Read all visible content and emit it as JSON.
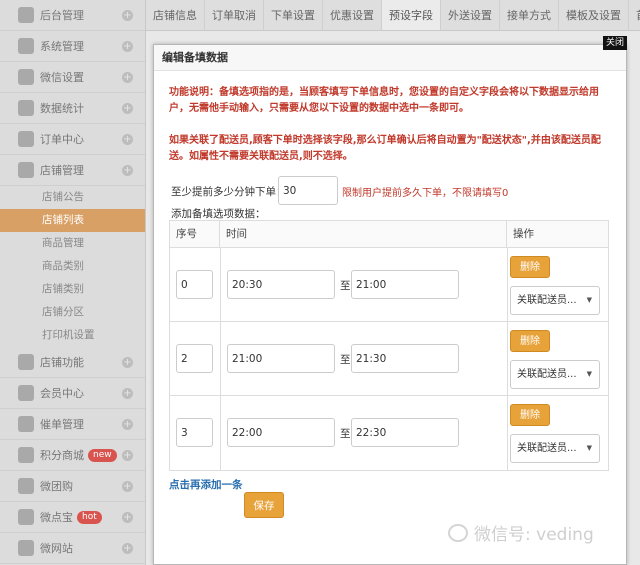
{
  "sidebar": {
    "items": [
      {
        "label": "后台管理",
        "icon": "grid-icon"
      },
      {
        "label": "系统管理",
        "icon": "grid-icon"
      },
      {
        "label": "微信设置",
        "icon": "mail-icon"
      },
      {
        "label": "数据统计",
        "icon": "chart-icon"
      },
      {
        "label": "订单中心",
        "icon": "cart-icon"
      },
      {
        "label": "店铺管理",
        "icon": "store-icon"
      }
    ],
    "store_sub": [
      "店铺公告",
      "店铺列表",
      "商品管理",
      "商品类别",
      "店铺类别",
      "店铺分区",
      "打印机设置"
    ],
    "active_sub": "店铺列表",
    "lower_items": [
      {
        "label": "店铺功能",
        "icon": "plus-icon",
        "badge": ""
      },
      {
        "label": "会员中心",
        "icon": "user-icon",
        "badge": ""
      },
      {
        "label": "催单管理",
        "icon": "grid-icon",
        "badge": ""
      },
      {
        "label": "积分商城",
        "icon": "gift-icon",
        "badge": "new"
      },
      {
        "label": "微团购",
        "icon": "group-icon",
        "badge": ""
      },
      {
        "label": "微点宝",
        "icon": "star-icon",
        "badge": "hot"
      },
      {
        "label": "微网站",
        "icon": "globe-icon",
        "badge": ""
      }
    ]
  },
  "tabs": [
    "店铺信息",
    "订单取消",
    "下单设置",
    "优惠设置",
    "预设字段",
    "外送设置",
    "接单方式",
    "模板及设置",
    "首页"
  ],
  "active_tab": "预设字段",
  "modal": {
    "close_label": "关闭",
    "title": "编辑备填数据",
    "desc1": "功能说明：备填选项指的是，当顾客填写下单信息时，您设置的自定义字段会将以下数据显示给用户，无需他手动输入，只需要从您以下设置的数据中选中一条即可。",
    "desc2": "如果关联了配送员,顾客下单时选择该字段,那么订单确认后将自动置为\"配送状态\",并由该配送员配送。如属性不需要关联配送员,则不选择。",
    "advance_label": "至少提前多少分钟下单：",
    "advance_value": "30",
    "advance_hint": "限制用户提前多久下单，不限请填写0",
    "table_label": "添加备填选项数据：",
    "headers": {
      "seq": "序号",
      "time": "时间",
      "op": "操作"
    },
    "to_label": "至",
    "delete_label": "删除",
    "select_placeholder": "关联配送员...",
    "rows": [
      {
        "seq": "0",
        "start": "20:30",
        "end": "21:00"
      },
      {
        "seq": "2",
        "start": "21:00",
        "end": "21:30"
      },
      {
        "seq": "3",
        "start": "22:00",
        "end": "22:30"
      }
    ],
    "add_link": "点击再添加一条",
    "save_label": "保存"
  },
  "watermark": "微信号: veding"
}
